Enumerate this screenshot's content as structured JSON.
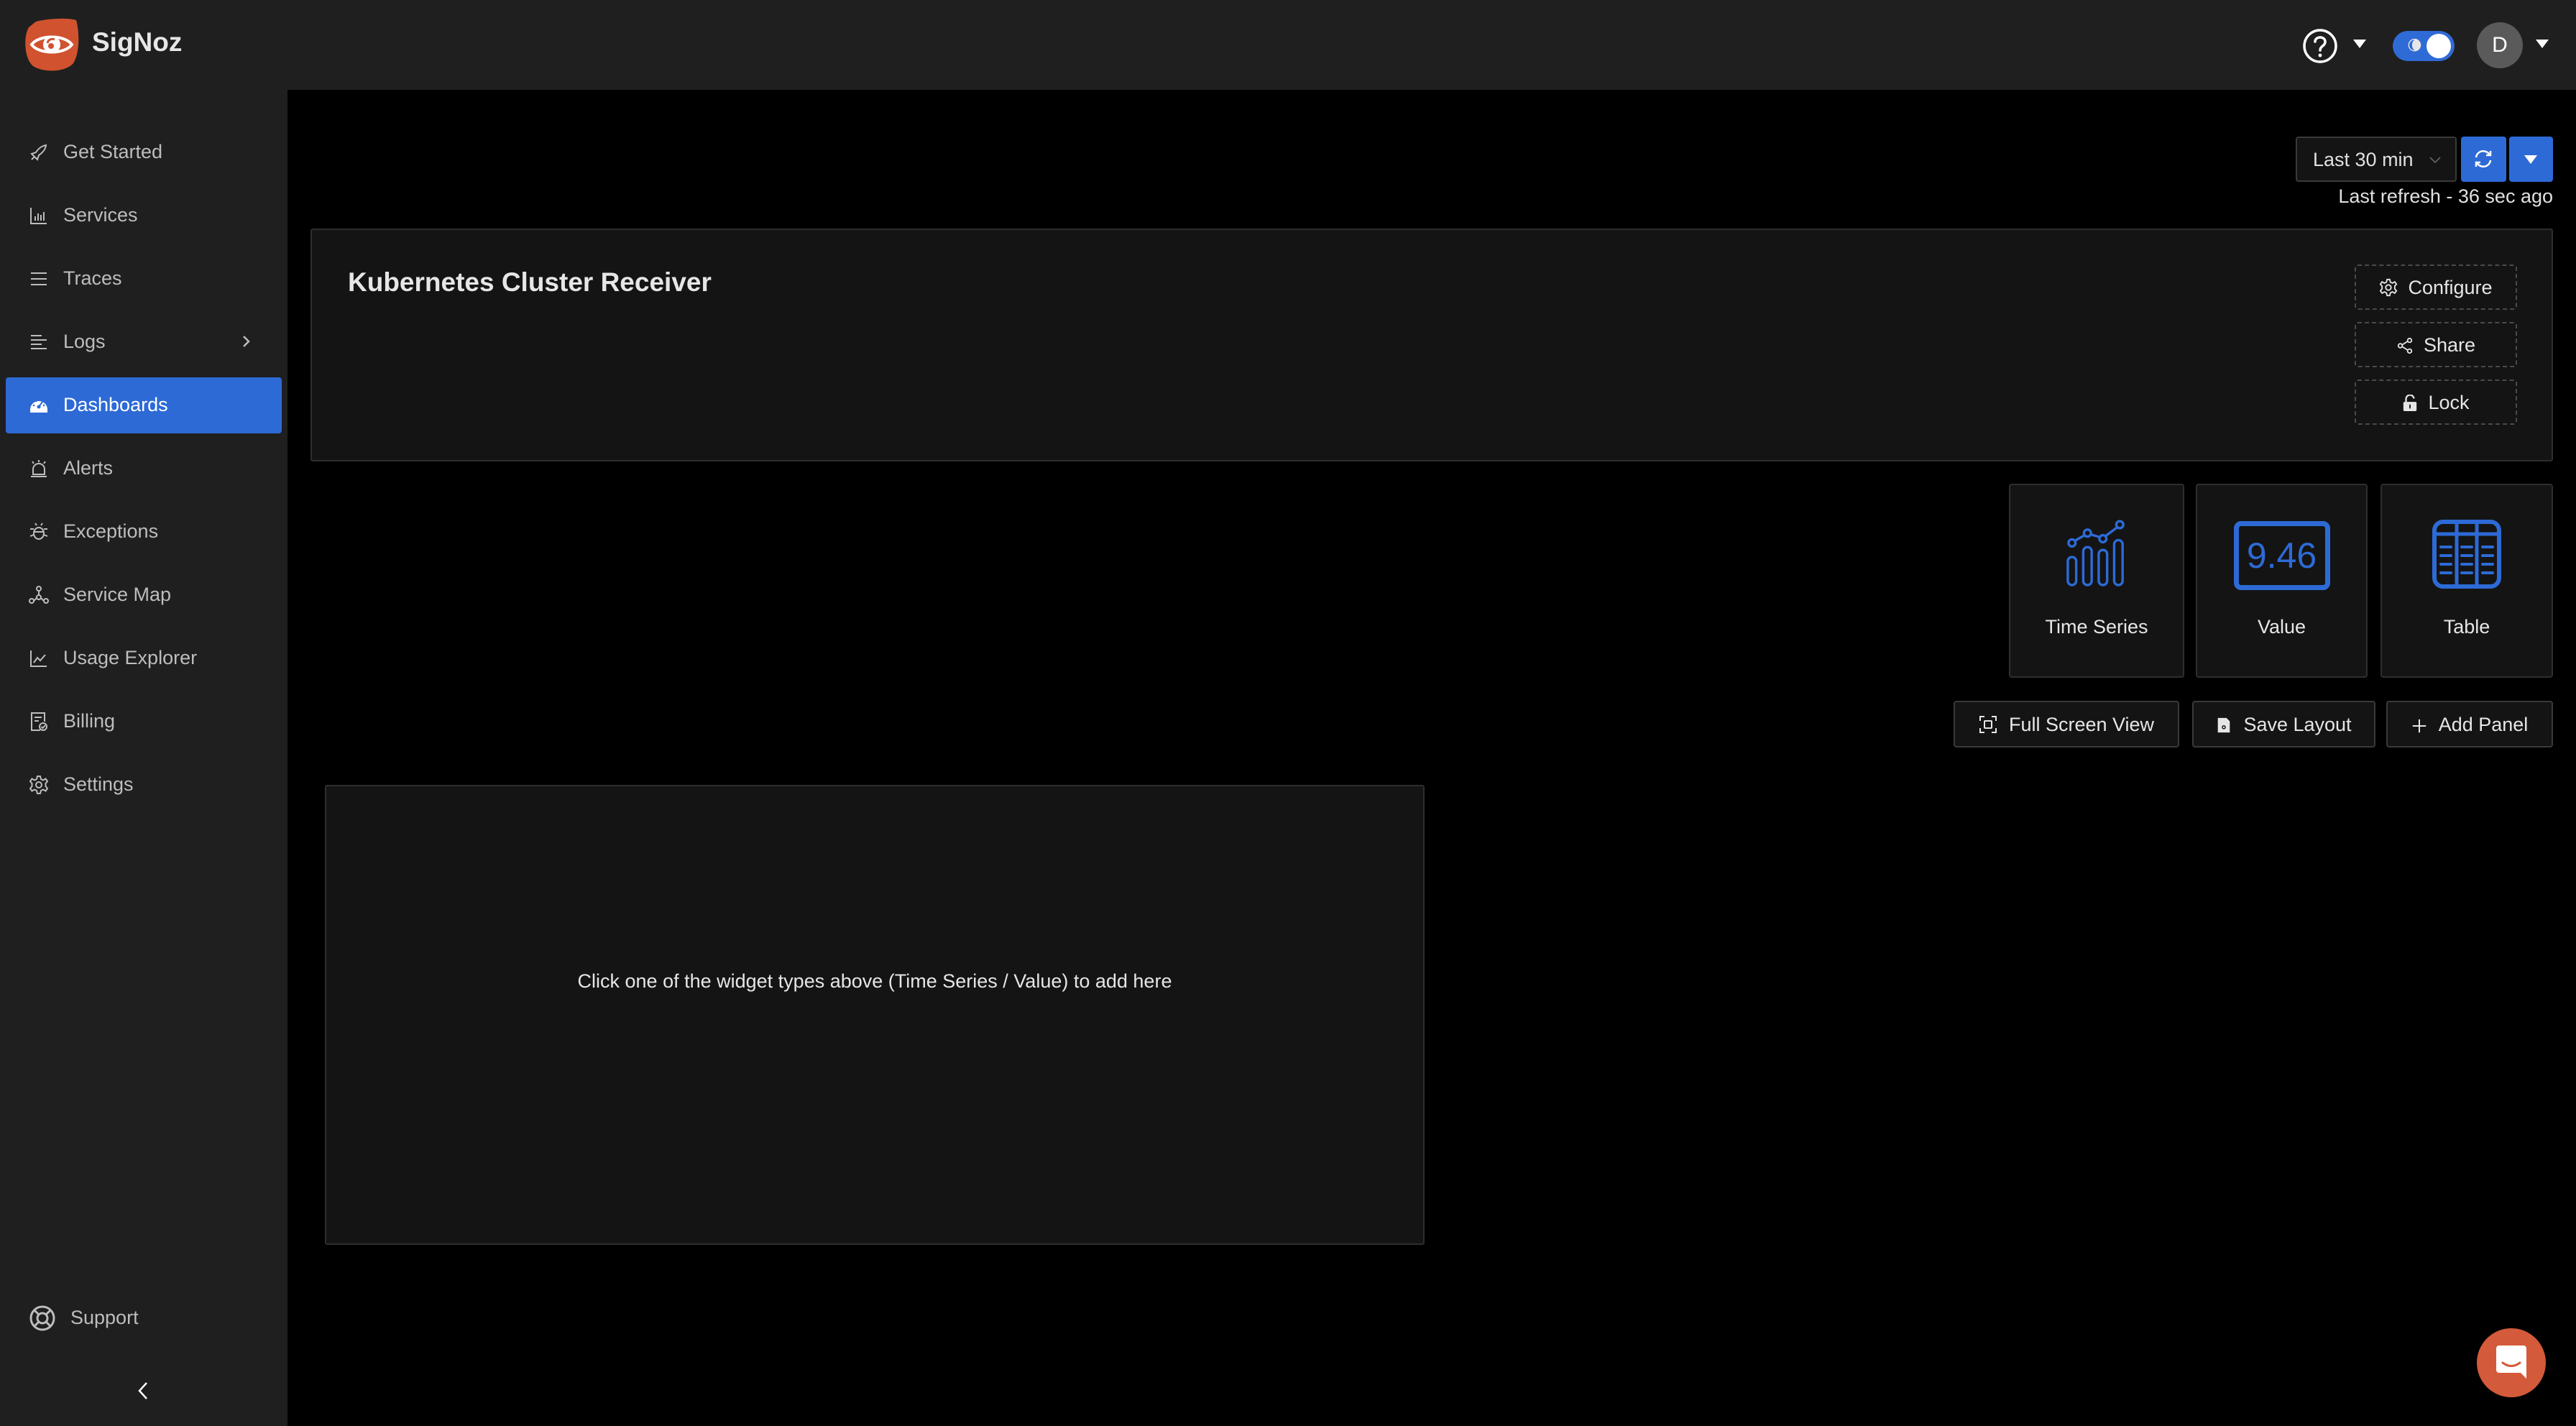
{
  "app": {
    "brand": "SigNoz"
  },
  "header": {
    "user_initial": "D"
  },
  "sidebar": {
    "items": [
      {
        "label": "Get Started",
        "icon": "rocket-icon"
      },
      {
        "label": "Services",
        "icon": "bar-chart-icon"
      },
      {
        "label": "Traces",
        "icon": "menu-lines-icon"
      },
      {
        "label": "Logs",
        "icon": "align-left-icon",
        "has_submenu": true
      },
      {
        "label": "Dashboards",
        "icon": "dashboard-gauge-icon",
        "active": true
      },
      {
        "label": "Alerts",
        "icon": "alarm-icon"
      },
      {
        "label": "Exceptions",
        "icon": "bug-icon"
      },
      {
        "label": "Service Map",
        "icon": "deployment-unit-icon"
      },
      {
        "label": "Usage Explorer",
        "icon": "line-chart-icon"
      },
      {
        "label": "Billing",
        "icon": "billing-icon"
      },
      {
        "label": "Settings",
        "icon": "gear-icon"
      }
    ],
    "support_label": "Support"
  },
  "toolbar": {
    "time_range": "Last 30 min",
    "last_refresh": "Last refresh - 36 sec ago"
  },
  "dashboard": {
    "title": "Kubernetes Cluster Receiver",
    "buttons": {
      "configure": "Configure",
      "share": "Share",
      "lock": "Lock"
    }
  },
  "widgets": {
    "types": [
      {
        "label": "Time Series",
        "icon": "time-series-icon"
      },
      {
        "label": "Value",
        "icon": "value-icon",
        "sample_value": "9.46"
      },
      {
        "label": "Table",
        "icon": "table-icon"
      }
    ]
  },
  "actions": {
    "full_screen": "Full Screen View",
    "save_layout": "Save Layout",
    "add_panel": "Add Panel"
  },
  "empty_panel": {
    "message": "Click one of the widget types above (Time Series / Value) to add here"
  },
  "colors": {
    "accent": "#2d6ad6",
    "brand": "#d35a3a",
    "sidebar_bg": "#1f1f1f",
    "card_bg": "#141414"
  }
}
